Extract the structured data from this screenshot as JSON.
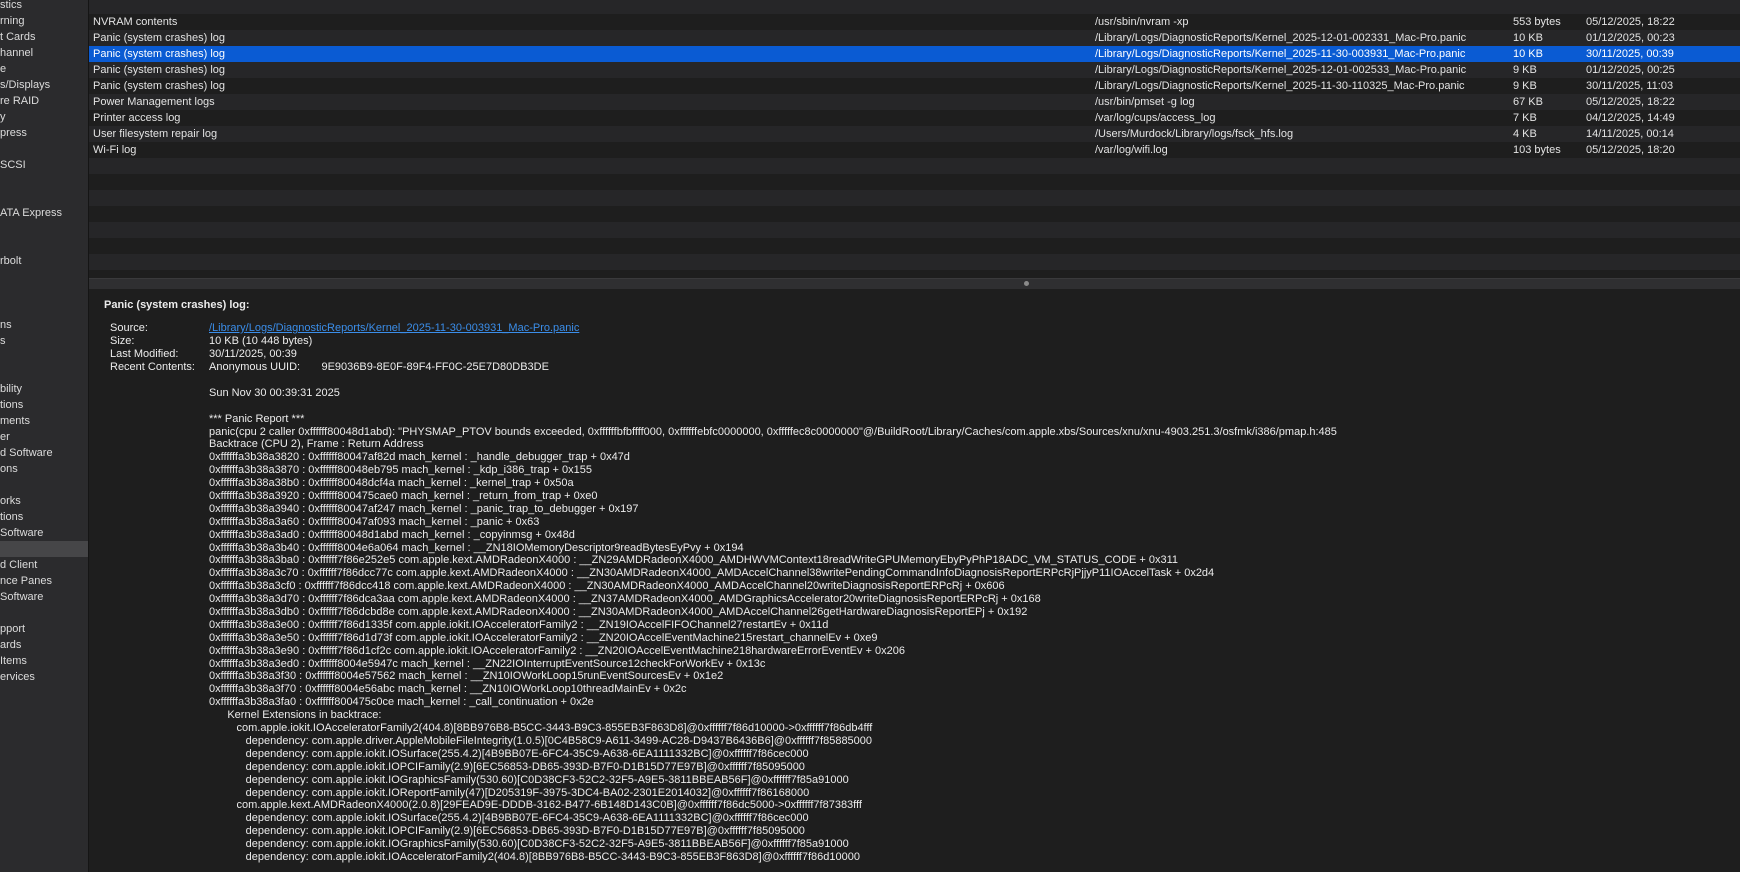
{
  "sidebar": {
    "items": [
      {
        "label": "stics"
      },
      {
        "label": "rning"
      },
      {
        "label": "t Cards"
      },
      {
        "label": "hannel"
      },
      {
        "label": "e"
      },
      {
        "label": "s/Displays"
      },
      {
        "label": "re RAID"
      },
      {
        "label": "y"
      },
      {
        "label": "press"
      },
      {
        "label": ""
      },
      {
        "label": "SCSI"
      },
      {
        "label": ""
      },
      {
        "label": ""
      },
      {
        "label": "ATA Express"
      },
      {
        "label": ""
      },
      {
        "label": ""
      },
      {
        "label": "rbolt"
      },
      {
        "label": ""
      },
      {
        "label": ""
      },
      {
        "label": ""
      },
      {
        "label": "ns"
      },
      {
        "label": "s"
      },
      {
        "label": ""
      },
      {
        "label": ""
      },
      {
        "label": "bility"
      },
      {
        "label": "tions"
      },
      {
        "label": "ments"
      },
      {
        "label": "er"
      },
      {
        "label": "d Software"
      },
      {
        "label": "ons"
      },
      {
        "label": ""
      },
      {
        "label": "orks"
      },
      {
        "label": "tions"
      },
      {
        "label": "Software"
      },
      {
        "label": ""
      },
      {
        "label": "d Client"
      },
      {
        "label": "nce Panes"
      },
      {
        "label": "Software"
      },
      {
        "label": ""
      },
      {
        "label": "pport"
      },
      {
        "label": "ards"
      },
      {
        "label": "Items"
      },
      {
        "label": "ervices"
      }
    ],
    "selected_index": 34
  },
  "list": {
    "rows": [
      {
        "name": "",
        "path": "",
        "size": "",
        "date": ""
      },
      {
        "name": "NVRAM contents",
        "path": "/usr/sbin/nvram -xp",
        "size": "553 bytes",
        "date": "05/12/2025, 18:22"
      },
      {
        "name": "Panic (system crashes) log",
        "path": "/Library/Logs/DiagnosticReports/Kernel_2025-12-01-002331_Mac-Pro.panic",
        "size": "10 KB",
        "date": "01/12/2025, 00:23"
      },
      {
        "name": "Panic (system crashes) log",
        "path": "/Library/Logs/DiagnosticReports/Kernel_2025-11-30-003931_Mac-Pro.panic",
        "size": "10 KB",
        "date": "30/11/2025, 00:39"
      },
      {
        "name": "Panic (system crashes) log",
        "path": "/Library/Logs/DiagnosticReports/Kernel_2025-12-01-002533_Mac-Pro.panic",
        "size": "9 KB",
        "date": "01/12/2025, 00:25"
      },
      {
        "name": "Panic (system crashes) log",
        "path": "/Library/Logs/DiagnosticReports/Kernel_2025-11-30-110325_Mac-Pro.panic",
        "size": "9 KB",
        "date": "30/11/2025, 11:03"
      },
      {
        "name": "Power Management logs",
        "path": "/usr/bin/pmset -g log",
        "size": "67 KB",
        "date": "05/12/2025, 18:22"
      },
      {
        "name": "Printer access log",
        "path": "/var/log/cups/access_log",
        "size": "7 KB",
        "date": "04/12/2025, 14:49"
      },
      {
        "name": "User filesystem repair log",
        "path": "/Users/Murdock/Library/logs/fsck_hfs.log",
        "size": "4 KB",
        "date": "14/11/2025, 00:14"
      },
      {
        "name": "Wi-Fi log",
        "path": "/var/log/wifi.log",
        "size": "103 bytes",
        "date": "05/12/2025, 18:20"
      },
      {
        "name": "",
        "path": "",
        "size": "",
        "date": ""
      },
      {
        "name": "",
        "path": "",
        "size": "",
        "date": ""
      },
      {
        "name": "",
        "path": "",
        "size": "",
        "date": ""
      },
      {
        "name": "",
        "path": "",
        "size": "",
        "date": ""
      },
      {
        "name": "",
        "path": "",
        "size": "",
        "date": ""
      },
      {
        "name": "",
        "path": "",
        "size": "",
        "date": ""
      },
      {
        "name": "",
        "path": "",
        "size": "",
        "date": ""
      },
      {
        "name": "",
        "path": "",
        "size": "",
        "date": ""
      }
    ],
    "selected_index": 3
  },
  "detail": {
    "title": "Panic (system crashes) log:",
    "source_label": "Source:",
    "source_value": "/Library/Logs/DiagnosticReports/Kernel_2025-11-30-003931_Mac-Pro.panic",
    "size_label": "Size:",
    "size_value": "10 KB (10 448 bytes)",
    "modified_label": "Last Modified:",
    "modified_value": "30/11/2025, 00:39",
    "recent_label": "Recent Contents:",
    "recent_value": "Anonymous UUID:       9E9036B9-8E0F-89F4-FF0C-25E7D80DB3DE",
    "lines": [
      "",
      "Sun Nov 30 00:39:31 2025",
      "",
      "*** Panic Report ***",
      "panic(cpu 2 caller 0xffffff80048d1abd): \"PHYSMAP_PTOV bounds exceeded, 0xffffffbfbffff000, 0xffffffebfc0000000, 0xfffffec8c0000000\"@/BuildRoot/Library/Caches/com.apple.xbs/Sources/xnu/xnu-4903.251.3/osfmk/i386/pmap.h:485",
      "Backtrace (CPU 2), Frame : Return Address",
      "0xffffffa3b38a3820 : 0xffffff80047af82d mach_kernel : _handle_debugger_trap + 0x47d",
      "0xffffffa3b38a3870 : 0xffffff80048eb795 mach_kernel : _kdp_i386_trap + 0x155",
      "0xffffffa3b38a38b0 : 0xffffff80048dcf4a mach_kernel : _kernel_trap + 0x50a",
      "0xffffffa3b38a3920 : 0xffffff800475cae0 mach_kernel : _return_from_trap + 0xe0",
      "0xffffffa3b38a3940 : 0xffffff80047af247 mach_kernel : _panic_trap_to_debugger + 0x197",
      "0xffffffa3b38a3a60 : 0xffffff80047af093 mach_kernel : _panic + 0x63",
      "0xffffffa3b38a3ad0 : 0xffffff80048d1abd mach_kernel : _copyinmsg + 0x48d",
      "0xffffffa3b38a3b40 : 0xffffff8004e6a064 mach_kernel : __ZN18IOMemoryDescriptor9readBytesEyPvy + 0x194",
      "0xffffffa3b38a3ba0 : 0xffffff7f86e252e5 com.apple.kext.AMDRadeonX4000 : __ZN29AMDRadeonX4000_AMDHWVMContext18readWriteGPUMemoryEbyPyPhP18ADC_VM_STATUS_CODE + 0x311",
      "0xffffffa3b38a3c70 : 0xffffff7f86dcc77c com.apple.kext.AMDRadeonX4000 : __ZN30AMDRadeonX4000_AMDAccelChannel38writePendingCommandInfoDiagnosisReportERPcRjPjjyP11IOAccelTask + 0x2d4",
      "0xffffffa3b38a3cf0 : 0xffffff7f86dcc418 com.apple.kext.AMDRadeonX4000 : __ZN30AMDRadeonX4000_AMDAccelChannel20writeDiagnosisReportERPcRj + 0x606",
      "0xffffffa3b38a3d70 : 0xffffff7f86dca3aa com.apple.kext.AMDRadeonX4000 : __ZN37AMDRadeonX4000_AMDGraphicsAccelerator20writeDiagnosisReportERPcRj + 0x168",
      "0xffffffa3b38a3db0 : 0xffffff7f86dcbd8e com.apple.kext.AMDRadeonX4000 : __ZN30AMDRadeonX4000_AMDAccelChannel26getHardwareDiagnosisReportEPj + 0x192",
      "0xffffffa3b38a3e00 : 0xffffff7f86d1335f com.apple.iokit.IOAcceleratorFamily2 : __ZN19IOAccelFIFOChannel27restartEv + 0x11d",
      "0xffffffa3b38a3e50 : 0xffffff7f86d1d73f com.apple.iokit.IOAcceleratorFamily2 : __ZN20IOAccelEventMachine215restart_channelEv + 0xe9",
      "0xffffffa3b38a3e90 : 0xffffff7f86d1cf2c com.apple.iokit.IOAcceleratorFamily2 : __ZN20IOAccelEventMachine218hardwareErrorEventEv + 0x206",
      "0xffffffa3b38a3ed0 : 0xffffff8004e5947c mach_kernel : __ZN22IOInterruptEventSource12checkForWorkEv + 0x13c",
      "0xffffffa3b38a3f30 : 0xffffff8004e57562 mach_kernel : __ZN10IOWorkLoop15runEventSourcesEv + 0x1e2",
      "0xffffffa3b38a3f70 : 0xffffff8004e56abc mach_kernel : __ZN10IOWorkLoop10threadMainEv + 0x2c",
      "0xffffffa3b38a3fa0 : 0xffffff800475c0ce mach_kernel : _call_continuation + 0x2e",
      "      Kernel Extensions in backtrace:",
      "         com.apple.iokit.IOAcceleratorFamily2(404.8)[8BB976B8-B5CC-3443-B9C3-855EB3F863D8]@0xffffff7f86d10000->0xffffff7f86db4fff",
      "            dependency: com.apple.driver.AppleMobileFileIntegrity(1.0.5)[0C4B58C9-A611-3499-AC28-D9437B6436B6]@0xffffff7f85885000",
      "            dependency: com.apple.iokit.IOSurface(255.4.2)[4B9BB07E-6FC4-35C9-A638-6EA1111332BC]@0xffffff7f86cec000",
      "            dependency: com.apple.iokit.IOPCIFamily(2.9)[6EC56853-DB65-393D-B7F0-D1B15D77E97B]@0xffffff7f85095000",
      "            dependency: com.apple.iokit.IOGraphicsFamily(530.60)[C0D38CF3-52C2-32F5-A9E5-3811BBEAB56F]@0xffffff7f85a91000",
      "            dependency: com.apple.iokit.IOReportFamily(47)[D205319F-3975-3DC4-BA02-2301E2014032]@0xffffff7f86168000",
      "         com.apple.kext.AMDRadeonX4000(2.0.8)[29FEAD9E-DDDB-3162-B477-6B148D143C0B]@0xffffff7f86dc5000->0xffffff7f87383fff",
      "            dependency: com.apple.iokit.IOSurface(255.4.2)[4B9BB07E-6FC4-35C9-A638-6EA1111332BC]@0xffffff7f86cec000",
      "            dependency: com.apple.iokit.IOPCIFamily(2.9)[6EC56853-DB65-393D-B7F0-D1B15D77E97B]@0xffffff7f85095000",
      "            dependency: com.apple.iokit.IOGraphicsFamily(530.60)[C0D38CF3-52C2-32F5-A9E5-3811BBEAB56F]@0xffffff7f85a91000",
      "            dependency: com.apple.iokit.IOAcceleratorFamily2(404.8)[8BB976B8-B5CC-3443-B9C3-855EB3F863D8]@0xffffff7f86d10000"
    ]
  }
}
